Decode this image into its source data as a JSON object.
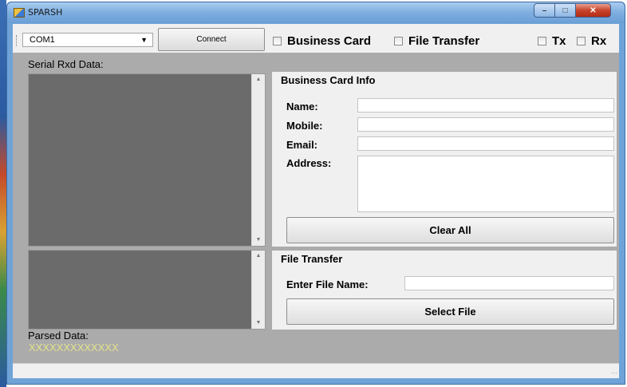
{
  "window": {
    "title": "SPARSH"
  },
  "toolbar": {
    "port_value": "COM1",
    "connect_label": "Connect",
    "business_card_label": "Business Card",
    "file_transfer_label": "File Transfer",
    "tx_label": "Tx",
    "rx_label": "Rx"
  },
  "serial": {
    "label": "Serial Rxd Data:"
  },
  "business_card": {
    "title": "Business Card Info",
    "name_label": "Name:",
    "mobile_label": "Mobile:",
    "email_label": "Email:",
    "address_label": "Address:",
    "name_value": "",
    "mobile_value": "",
    "email_value": "",
    "address_value": "",
    "clear_label": "Clear All"
  },
  "file_transfer": {
    "title": "File Transfer",
    "file_name_label": "Enter File Name:",
    "file_name_value": "",
    "select_label": "Select File"
  },
  "parsed": {
    "label": "Parsed Data:",
    "value": "XXXXXXXXXXXXX"
  },
  "colors": {
    "client_bg": "#ababab",
    "textarea_bg": "#6b6b6b",
    "parsed_text": "#e2e28a",
    "titlebar": "#7eaee0"
  }
}
